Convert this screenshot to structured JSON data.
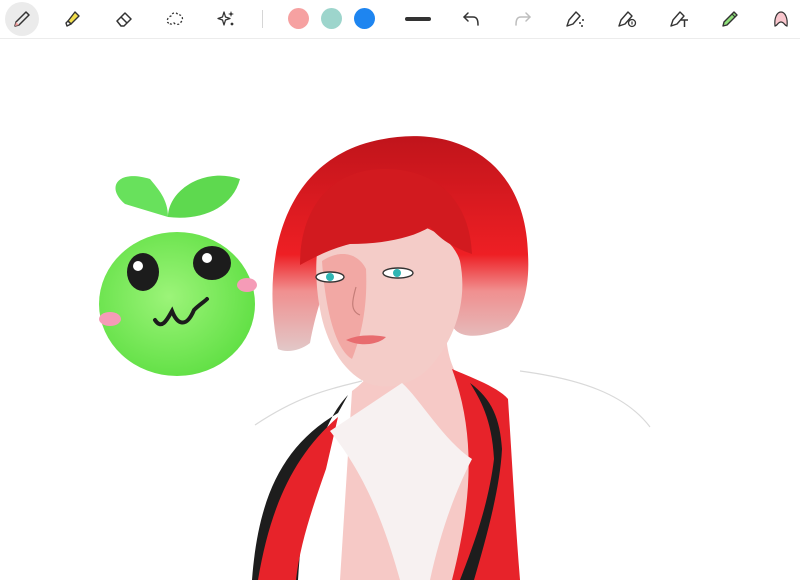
{
  "toolbar": {
    "tools": [
      {
        "icon": "pencil-icon",
        "state": "selected"
      },
      {
        "icon": "highlighter-icon"
      },
      {
        "icon": "eraser-icon"
      },
      {
        "icon": "lasso-select-icon"
      },
      {
        "icon": "sparkles-icon"
      },
      {
        "icon": "stroke-width-icon"
      },
      {
        "icon": "undo-icon"
      },
      {
        "icon": "redo-icon",
        "state": "disabled"
      },
      {
        "icon": "magic-pen-icon"
      },
      {
        "icon": "pen-settings-icon"
      },
      {
        "icon": "text-pen-icon"
      },
      {
        "icon": "marker-icon"
      },
      {
        "icon": "profile-avatar-icon"
      }
    ],
    "colors": [
      {
        "name": "pink",
        "hex": "#f6a1a1"
      },
      {
        "name": "teal",
        "hex": "#9dd5cc"
      },
      {
        "name": "blue",
        "hex": "#1e85f0",
        "selected": true
      }
    ]
  },
  "canvas": {
    "background": "#ffffff",
    "drawings": [
      "green-apple-mascot",
      "red-haired-woman-portrait"
    ]
  }
}
